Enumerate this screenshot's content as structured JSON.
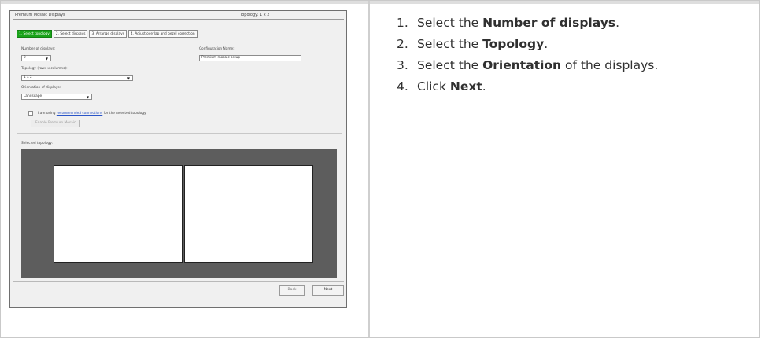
{
  "screenshot": {
    "window_title": "Premium Mosaic Displays",
    "topology_readout": "Topology: 1 x 2",
    "tabs": [
      {
        "label": "1. Select topology",
        "active": true
      },
      {
        "label": "2. Select displays",
        "active": false
      },
      {
        "label": "3. Arrange displays",
        "active": false
      },
      {
        "label": "4. Adjust overlap and bezel correction",
        "active": false
      }
    ],
    "number_of_displays_label": "Number of displays:",
    "number_of_displays_value": "2",
    "configuration_name_label": "Configuration Name:",
    "configuration_name_value": "Premium mosaic setup",
    "topology_label": "Topology (rows x columns):",
    "topology_value": "1 x 2",
    "orientation_label": "Orientation of displays:",
    "orientation_value": "Landscape",
    "checkbox_text_before": "I am using",
    "checkbox_link_text": "recommended connections",
    "checkbox_text_after": "for the selected topology.",
    "enable_button_label": "Enable Premium Mosaic",
    "selected_topology_label": "Selected topology:",
    "back_button_label": "Back",
    "next_button_label": "Next"
  },
  "instructions": [
    {
      "num": "1.",
      "before": "Select the ",
      "bold": "Number of displays",
      "after": "."
    },
    {
      "num": "2.",
      "before": "Select the ",
      "bold": "Topology",
      "after": "."
    },
    {
      "num": "3.",
      "before": "Select the ",
      "bold": "Orientation",
      "after": " of the displays."
    },
    {
      "num": "4.",
      "before": "Click ",
      "bold": "Next",
      "after": "."
    }
  ]
}
